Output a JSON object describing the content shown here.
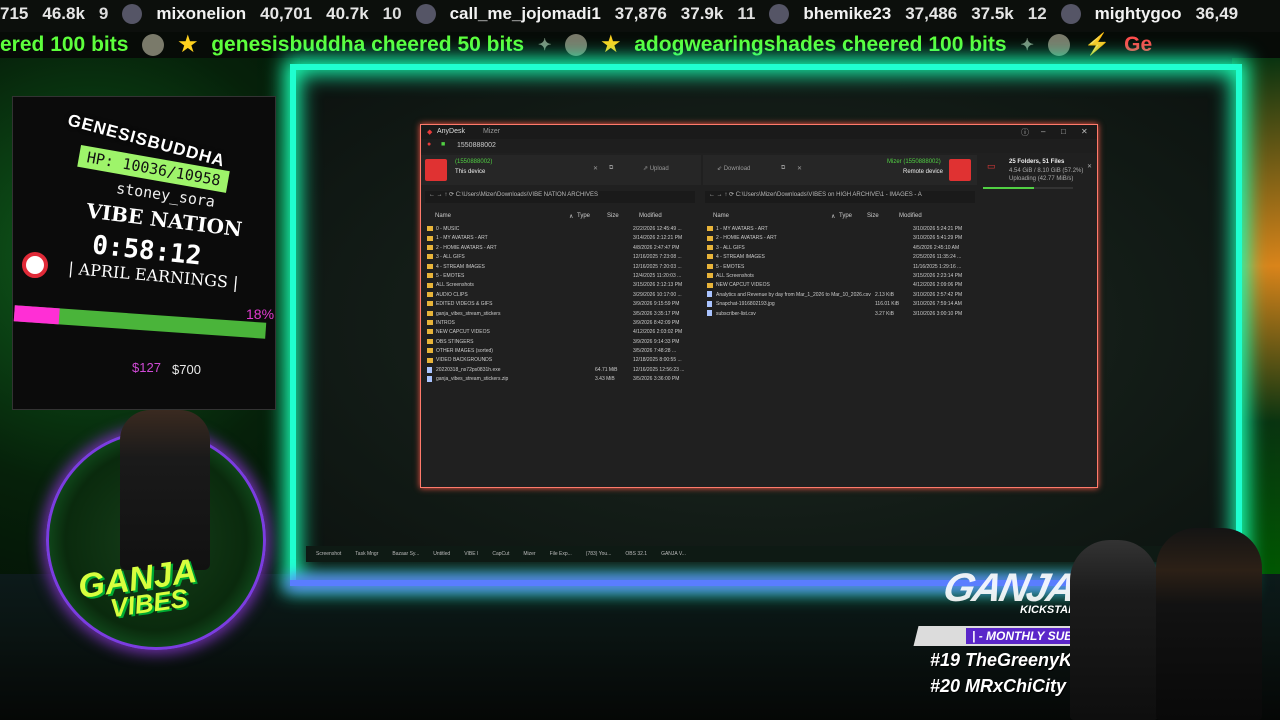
{
  "leaderboard_ticker": [
    {
      "rank": "",
      "name": "",
      "score": "715",
      "short": "46.8k"
    },
    {
      "rank": "9",
      "name": "mixonelion",
      "score": "40,701",
      "short": "40.7k"
    },
    {
      "rank": "10",
      "name": "call_me_jojomadi1",
      "score": "37,876",
      "short": "37.9k"
    },
    {
      "rank": "11",
      "name": "bhemike23",
      "score": "37,486",
      "short": "37.5k"
    },
    {
      "rank": "12",
      "name": "mightygoo",
      "score": "36,49",
      "short": ""
    }
  ],
  "cheer_ticker": {
    "fragment": "ered 100 bits",
    "items": [
      "genesisbuddha cheered 50 bits",
      "adogwearingshades cheered 100 bits"
    ],
    "tail": "Ge"
  },
  "hud": {
    "name": "GENESISBUDDHA",
    "hp": "HP: 10036/10958",
    "user": "stoney_sora",
    "title": "VIBE NATION",
    "timer": "0:58:12",
    "earnings_label": "| APRIL EARNINGS |",
    "percent": "18%",
    "progress": 0.18,
    "current": "$127",
    "goal": "$700"
  },
  "badge": {
    "line1": "GANJA",
    "line2": "VIBES"
  },
  "anydesk": {
    "app_name": "AnyDesk",
    "tab2": "Mizer",
    "address": "1550888002",
    "local": {
      "id": "(1550888002)",
      "label": "This device",
      "upload": "Upload",
      "path": "C:\\Users\\Mizer\\Downloads\\VIBE NATION ARCHIVES",
      "columns": [
        "Name",
        "Type",
        "Size",
        "Modified"
      ],
      "rows": [
        {
          "icon": "folder",
          "name": "0 - MUSIC",
          "size": "",
          "modified": "2/22/2026 12:45:49 ..."
        },
        {
          "icon": "folder",
          "name": "1 - MY AVATARS - ART",
          "size": "",
          "modified": "3/14/2026 2:12:21 PM"
        },
        {
          "icon": "folder",
          "name": "2 - HOMIE AVATARS - ART",
          "size": "",
          "modified": "4/8/2026 2:47:47 PM"
        },
        {
          "icon": "folder",
          "name": "3 - ALL GIFS",
          "size": "",
          "modified": "12/16/2025 7:23:08 ..."
        },
        {
          "icon": "folder",
          "name": "4 - STREAM IMAGES",
          "size": "",
          "modified": "12/16/2025 7:20:03 ..."
        },
        {
          "icon": "folder",
          "name": "5 - EMOTES",
          "size": "",
          "modified": "12/4/2025 11:20:03 ..."
        },
        {
          "icon": "folder",
          "name": "ALL Screenshots",
          "size": "",
          "modified": "3/15/2026 2:12:13 PM"
        },
        {
          "icon": "folder",
          "name": "AUDIO CLIPS",
          "size": "",
          "modified": "3/29/2026 10:17:00 ..."
        },
        {
          "icon": "folder",
          "name": "EDITED VIDEOS & GIFS",
          "size": "",
          "modified": "3/9/2026 9:15:59 PM"
        },
        {
          "icon": "folder",
          "name": "ganja_vibes_stream_stickers",
          "size": "",
          "modified": "3/5/2026 3:35:17 PM"
        },
        {
          "icon": "folder",
          "name": "INTROS",
          "size": "",
          "modified": "3/9/2026 8:42:09 PM"
        },
        {
          "icon": "folder",
          "name": "NEW CAPCUT VIDEOS",
          "size": "",
          "modified": "4/12/2026 2:03:02 PM"
        },
        {
          "icon": "folder",
          "name": "OBS STINGERS",
          "size": "",
          "modified": "3/9/2026 9:14:33 PM"
        },
        {
          "icon": "folder",
          "name": "OTHER IMAGES (sorted)",
          "size": "",
          "modified": "3/5/2026 7:48:28 ..."
        },
        {
          "icon": "folder",
          "name": "VIDEO BACKGROUNDS",
          "size": "",
          "modified": "12/18/2025 8:00:55 ..."
        },
        {
          "icon": "file",
          "name": "20220318_ns72ps0831h.exe",
          "size": "64.71 MiB",
          "modified": "12/16/2025 12:56:23 ..."
        },
        {
          "icon": "file",
          "name": "ganja_vibes_stream_stickers.zip",
          "size": "3.43 MiB",
          "modified": "3/5/2026 3:36:00 PM"
        }
      ]
    },
    "remote": {
      "id": "Mizer (1550888002)",
      "label": "Remote device",
      "download": "Download",
      "path": "C:\\Users\\Mizer\\Downloads\\VIBES on HIGH  ARCHIVE\\1 - IMAGES - A",
      "columns": [
        "Name",
        "Type",
        "Size",
        "Modified"
      ],
      "rows": [
        {
          "icon": "folder",
          "name": "1 - MY AVATARS - ART",
          "size": "",
          "modified": "3/10/2026 5:24:21 PM"
        },
        {
          "icon": "folder",
          "name": "2 - HOMIE AVATARS - ART",
          "size": "",
          "modified": "3/10/2026 5:41:29 PM"
        },
        {
          "icon": "folder",
          "name": "3 - ALL GIFS",
          "size": "",
          "modified": "4/5/2026 2:45:10 AM"
        },
        {
          "icon": "folder",
          "name": "4 - STREAM IMAGES",
          "size": "",
          "modified": "2/25/2026 11:35:24 ..."
        },
        {
          "icon": "folder",
          "name": "5 - EMOTES",
          "size": "",
          "modified": "11/16/2025 1:29:16 ..."
        },
        {
          "icon": "folder",
          "name": "ALL Screenshots",
          "size": "",
          "modified": "3/15/2026 2:23:14 PM"
        },
        {
          "icon": "folder",
          "name": "NEW CAPCUT VIDEOS",
          "size": "",
          "modified": "4/12/2026 2:09:06 PM"
        },
        {
          "icon": "file",
          "name": "Analytics and Revenue by day from Mar_1_2026 to Mar_10_2026.csv",
          "size": "2.13 KiB",
          "modified": "3/10/2026 2:57:42 PM"
        },
        {
          "icon": "file",
          "name": "Snapchat-1916802193.jpg",
          "size": "116.01 KiB",
          "modified": "3/10/2026 7:59:14 AM"
        },
        {
          "icon": "file",
          "name": "subscriber-list.csv",
          "size": "3.27 KiB",
          "modified": "3/10/2026 3:00:10 PM"
        }
      ]
    },
    "transfer": {
      "title": "25 Folders, 51 Files",
      "size": "4.54 GiB / 8.10 GiB (57.2%)",
      "status": "Uploading (42.77 MiB/s)",
      "progress": 0.572
    }
  },
  "taskbar": [
    "Screenshot",
    "Task Mngr",
    "Bazaar Sy...",
    "Untitled",
    "VIBE I",
    "CapCut",
    "Mizer",
    "File Exp...",
    "(783) You...",
    "OBS 32.1",
    "GANJA V..."
  ],
  "overlay_bottom": {
    "kick_label": "KICKSTART!",
    "subgoal": "| - MONTHLY SUB GOAL",
    "lb19": "#19  TheGreenyK",
    "lb20": "#20  MRxChiCity",
    "brand": "GANJA VIBES"
  }
}
